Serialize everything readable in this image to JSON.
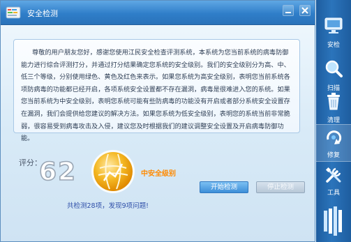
{
  "window": {
    "title": "安全检测"
  },
  "description": {
    "text": "尊敬的用户朋友您好，感谢您使用江民安全检查评测系统，本系统为您当前系统的病毒防御能力进行综合评测打分，并通过打分结果确定您系统的安全级别。我们的安全级别分为高、中、低三个等级，分别使用绿色、黄色及红色来表示。如果您系统为高安全级别，表明您当前系统各项防病毒的功能都已经开启，各项系统安全设置都不存在漏洞，病毒是很难进入您的系统。如果您当前系统为中安全级别，表明您系统可能有些防病毒的功能没有开启或者部分系统安全设置存在漏洞，我们会提供给您建议的解决方法。如果您系统为低安全级别，表明您的系统当前非常脆弱，很容易受到病毒攻击及入侵，建议您及时根据我们的建议调整安全设置及开启病毒防御功能。"
  },
  "score": {
    "label": "评分：",
    "value": "62",
    "level_text": "中安全级别",
    "level_color": "#ff8a00",
    "summary": "共检测28项，发现9项问题!"
  },
  "buttons": {
    "start": "开始检测",
    "stop": "停止检测"
  },
  "sidebar": {
    "items": [
      {
        "label": "安检",
        "icon": "monitor-icon"
      },
      {
        "label": "扫描",
        "icon": "magnifier-icon"
      },
      {
        "label": "清理",
        "icon": "trash-icon"
      },
      {
        "label": "修复",
        "icon": "repair-arrow-icon"
      },
      {
        "label": "工具",
        "icon": "tools-icon"
      }
    ],
    "bottom_icon": "brand-logo-icon"
  },
  "colors": {
    "title_bar": "#2f7ec9",
    "accent": "#3d8ed8",
    "sidebar": "#2b74bb"
  }
}
